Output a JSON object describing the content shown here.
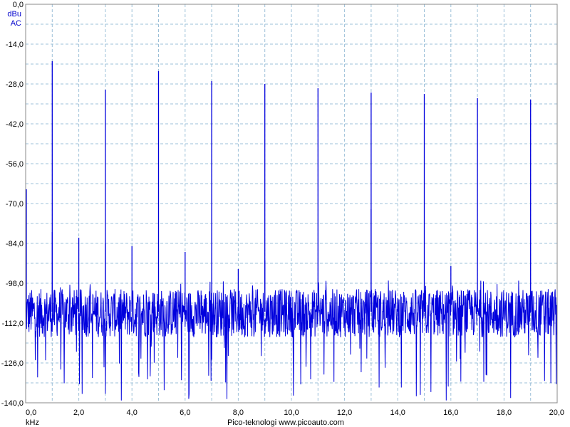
{
  "chart_data": {
    "type": "line",
    "y_unit": "dBu",
    "y_coupling": "AC",
    "x_unit": "kHz",
    "credit": "Pico-teknologi   www.picoauto.com",
    "xlim": [
      0,
      20
    ],
    "ylim": [
      -140,
      0
    ],
    "x_ticks": [
      "0,0",
      "2,0",
      "4,0",
      "6,0",
      "8,0",
      "10,0",
      "12,0",
      "14,0",
      "16,0",
      "18,0",
      "20,0"
    ],
    "y_ticks": [
      "0,0",
      "-14,0",
      "-28,0",
      "-42,0",
      "-56,0",
      "-70,0",
      "-84,0",
      "-98,0",
      "-112,0",
      "-126,0",
      "-140,0"
    ],
    "grid": true,
    "colors": {
      "trace": "#0000dd",
      "grid": "#9cc0d8"
    },
    "noise_floor_db": [
      -117,
      -100
    ],
    "series": [
      {
        "peaks": [
          {
            "x": 0.0,
            "y": -65
          },
          {
            "x": 1.0,
            "y": -20
          },
          {
            "x": 3.0,
            "y": -30
          },
          {
            "x": 5.0,
            "y": -23.5
          },
          {
            "x": 7.0,
            "y": -27
          },
          {
            "x": 9.0,
            "y": -28
          },
          {
            "x": 11.0,
            "y": -29.5
          },
          {
            "x": 13.0,
            "y": -31
          },
          {
            "x": 15.0,
            "y": -31.5
          },
          {
            "x": 17.0,
            "y": -33
          },
          {
            "x": 19.0,
            "y": -33.5
          },
          {
            "x": 1.0,
            "y": -80
          },
          {
            "x": 2.0,
            "y": -82
          },
          {
            "x": 3.0,
            "y": -84
          },
          {
            "x": 4.0,
            "y": -85
          },
          {
            "x": 6.0,
            "y": -87
          },
          {
            "x": 8.0,
            "y": -93
          },
          {
            "x": 9.0,
            "y": -90
          },
          {
            "x": 13.0,
            "y": -72
          },
          {
            "x": 16.0,
            "y": -92
          }
        ]
      }
    ]
  }
}
